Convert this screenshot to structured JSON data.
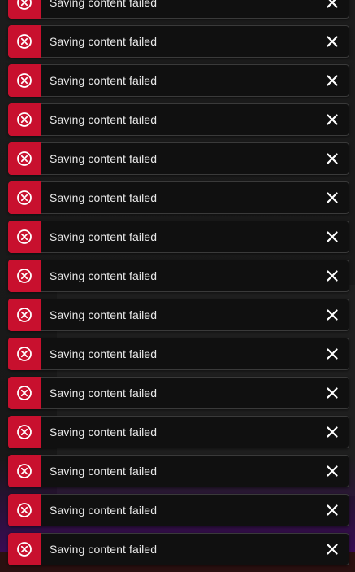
{
  "colors": {
    "error_red": "#c8102e",
    "toast_background": "#101010",
    "toast_border": "#3a3a3a",
    "text": "#e8e8e8"
  },
  "toasts": [
    {
      "message": "Saving content failed",
      "icon": "error-circle-x-icon",
      "close_icon": "close-icon"
    },
    {
      "message": "Saving content failed",
      "icon": "error-circle-x-icon",
      "close_icon": "close-icon"
    },
    {
      "message": "Saving content failed",
      "icon": "error-circle-x-icon",
      "close_icon": "close-icon"
    },
    {
      "message": "Saving content failed",
      "icon": "error-circle-x-icon",
      "close_icon": "close-icon"
    },
    {
      "message": "Saving content failed",
      "icon": "error-circle-x-icon",
      "close_icon": "close-icon"
    },
    {
      "message": "Saving content failed",
      "icon": "error-circle-x-icon",
      "close_icon": "close-icon"
    },
    {
      "message": "Saving content failed",
      "icon": "error-circle-x-icon",
      "close_icon": "close-icon"
    },
    {
      "message": "Saving content failed",
      "icon": "error-circle-x-icon",
      "close_icon": "close-icon"
    },
    {
      "message": "Saving content failed",
      "icon": "error-circle-x-icon",
      "close_icon": "close-icon"
    },
    {
      "message": "Saving content failed",
      "icon": "error-circle-x-icon",
      "close_icon": "close-icon"
    },
    {
      "message": "Saving content failed",
      "icon": "error-circle-x-icon",
      "close_icon": "close-icon"
    },
    {
      "message": "Saving content failed",
      "icon": "error-circle-x-icon",
      "close_icon": "close-icon"
    },
    {
      "message": "Saving content failed",
      "icon": "error-circle-x-icon",
      "close_icon": "close-icon"
    },
    {
      "message": "Saving content failed",
      "icon": "error-circle-x-icon",
      "close_icon": "close-icon"
    },
    {
      "message": "Saving content failed",
      "icon": "error-circle-x-icon",
      "close_icon": "close-icon"
    }
  ]
}
